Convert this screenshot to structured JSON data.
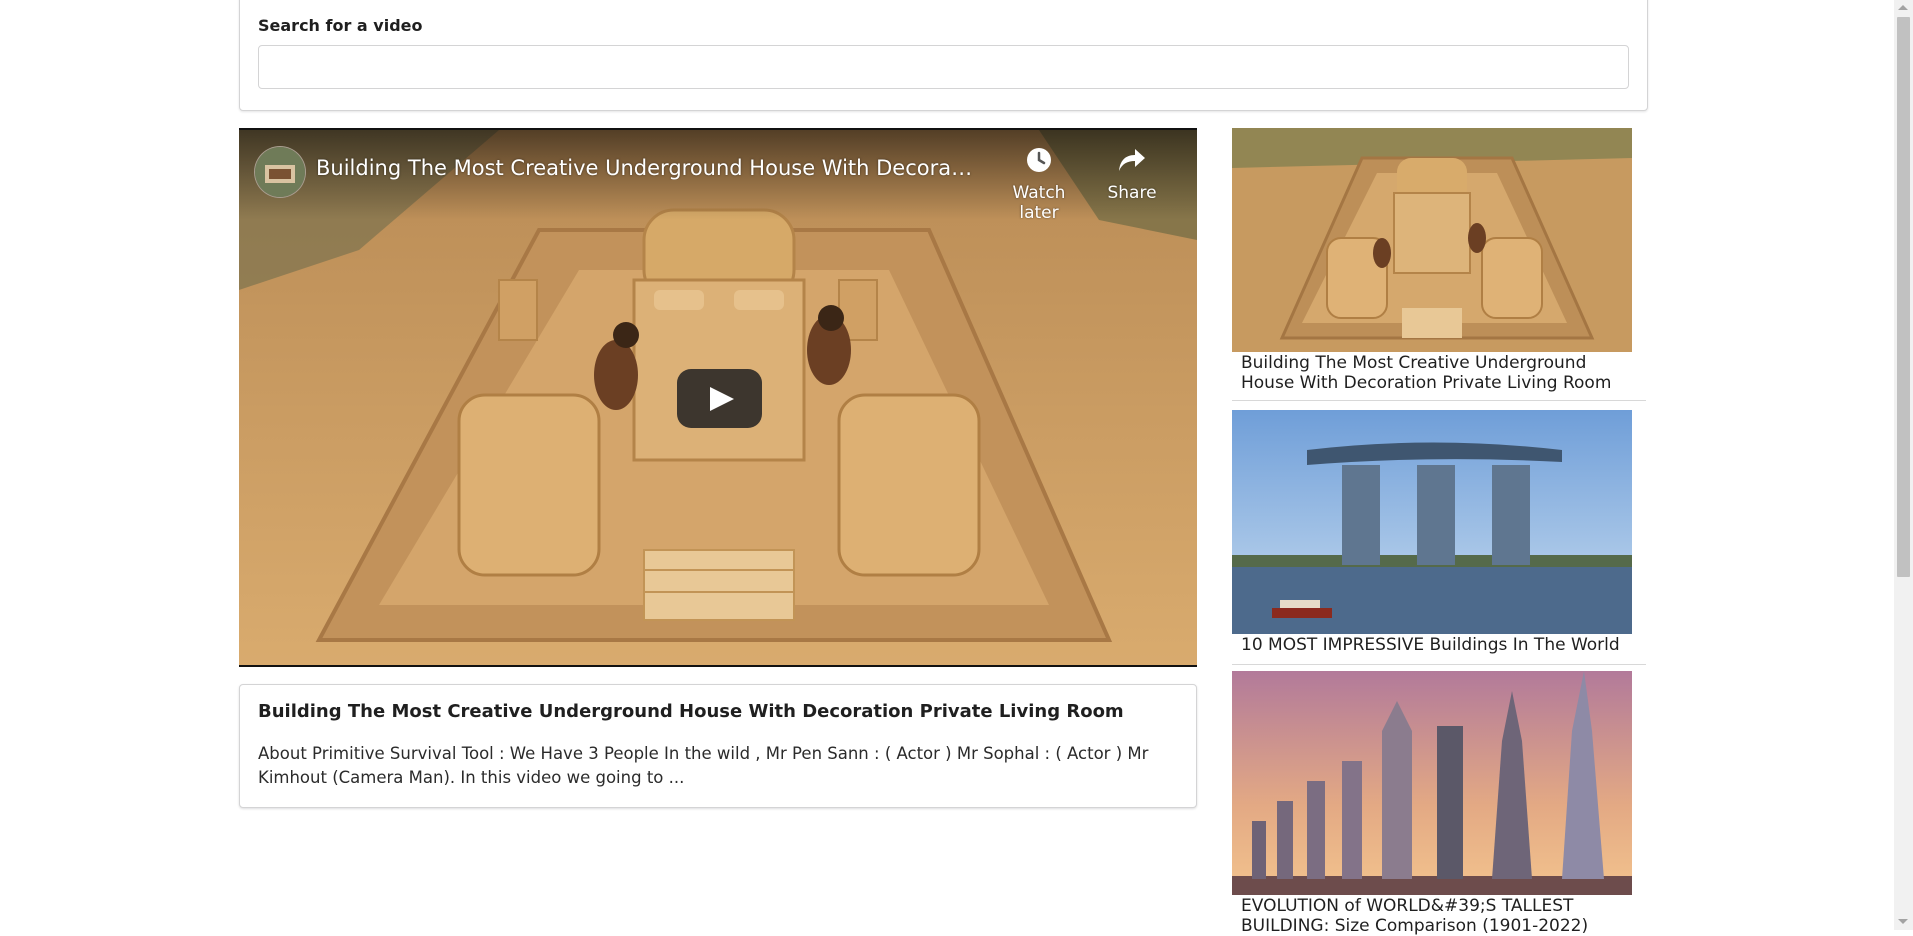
{
  "search": {
    "label": "Search for a video",
    "value": "",
    "placeholder": ""
  },
  "player": {
    "title": "Building The Most Creative Underground House With Decoration ...",
    "watch_later_label": "Watch later",
    "share_label": "Share",
    "icons": {
      "watch_later": "clock-icon",
      "share": "share-arrow-icon",
      "play": "play-icon"
    }
  },
  "selected_video": {
    "title": "Building The Most Creative Underground House With Decoration Private Living Room",
    "description": "About Primitive Survival Tool : We Have 3 People In the wild , Mr Pen Sann : ( Actor ) Mr Sophal : ( Actor ) Mr Kimhout (Camera Man). In this video we going to ..."
  },
  "video_list": [
    {
      "title": "Building The Most Creative Underground House With Decoration Private Living Room"
    },
    {
      "title": "10 MOST IMPRESSIVE Buildings In The World"
    },
    {
      "title": "EVOLUTION of WORLD&#39;S TALLEST BUILDING: Size Comparison (1901-2022)"
    }
  ],
  "colors": {
    "play_button": "#212121",
    "card_border": "#d4d4d5",
    "sand": "#cfa468"
  }
}
